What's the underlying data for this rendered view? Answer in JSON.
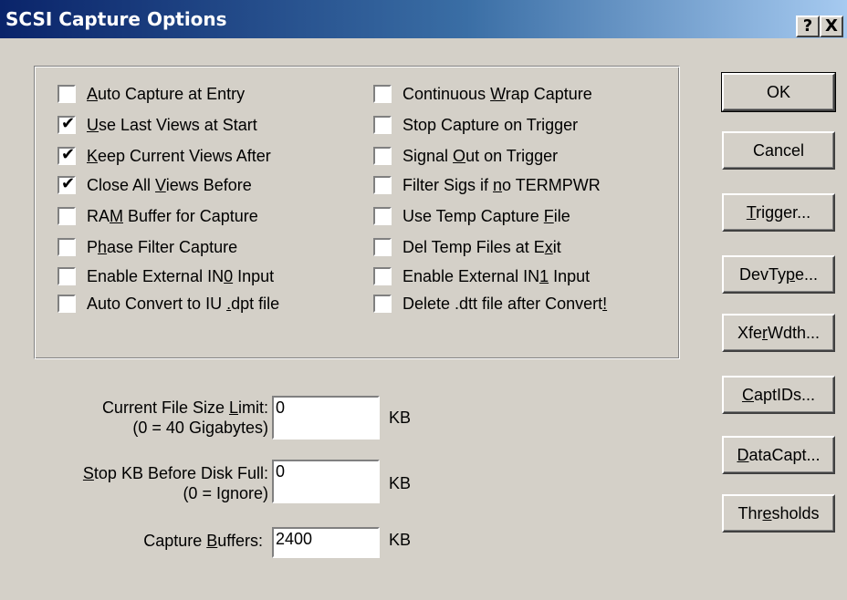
{
  "window": {
    "title": "SCSI Capture Options",
    "help_btn": "?",
    "close_btn": "X"
  },
  "left_checks": [
    {
      "text": "Auto Capture at Entry",
      "checked": false
    },
    {
      "text": "Use Last Views at Start",
      "checked": true
    },
    {
      "text": "Keep Current Views After",
      "checked": true
    },
    {
      "text": "Close All Views Before",
      "checked": true
    },
    {
      "text": "RAM Buffer for Capture",
      "checked": false
    },
    {
      "text": "Phase Filter Capture",
      "checked": false
    },
    {
      "text": "Enable External IN0 Input",
      "checked": false
    },
    {
      "text": "Auto Convert to IU .dpt file",
      "checked": false
    }
  ],
  "right_checks": [
    {
      "text": "Continuous Wrap Capture",
      "checked": false
    },
    {
      "text": "Stop Capture on Trigger",
      "checked": false
    },
    {
      "text": "Signal Out on Trigger",
      "checked": false
    },
    {
      "text": "Filter Sigs if no TERMPWR",
      "checked": false
    },
    {
      "text": "Use Temp Capture File",
      "checked": false
    },
    {
      "text": "Del Temp Files at Exit",
      "checked": false
    },
    {
      "text": "Enable External IN1 Input",
      "checked": false
    },
    {
      "text": "Delete .dtt file after Convert!",
      "checked": false
    }
  ],
  "fields": {
    "file_size": {
      "label1": "Current File Size Limit:",
      "label2": "(0 = 40 Gigabytes)",
      "value": "0",
      "unit": "KB"
    },
    "stop_kb": {
      "label1": "Stop KB Before Disk Full:",
      "label2": "(0 = Ignore)",
      "value": "0",
      "unit": "KB"
    },
    "buffers": {
      "label1": "Capture Buffers:",
      "value": "2400",
      "unit": "KB"
    }
  },
  "buttons": {
    "ok": "OK",
    "cancel": "Cancel",
    "trigger": "Trigger...",
    "devtype": "DevType...",
    "xferwdth": "XferWdth...",
    "captids": "CaptIDs...",
    "datacapt": "DataCapt...",
    "thresholds": "Thresholds"
  }
}
